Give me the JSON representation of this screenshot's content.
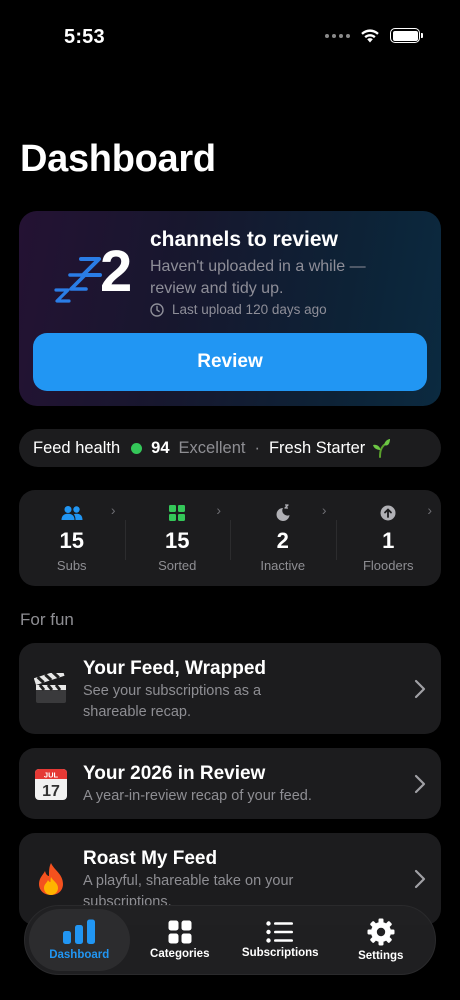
{
  "status_bar": {
    "time": "5:53"
  },
  "page": {
    "title": "Dashboard"
  },
  "review_card": {
    "count": "2",
    "title": "channels to review",
    "subtitle": "Haven't uploaded in a while — review and tidy up.",
    "last_upload": "Last upload 120 days ago",
    "button_label": "Review",
    "icon": "zzz-sleep-icon"
  },
  "feed_health": {
    "label": "Feed health",
    "score": "94",
    "rating": "Excellent",
    "separator": "·",
    "badge": "Fresh Starter",
    "status_color": "#34c759"
  },
  "stats": [
    {
      "value": "15",
      "label": "Subs",
      "icon": "people-icon"
    },
    {
      "value": "15",
      "label": "Sorted",
      "icon": "grid-icon"
    },
    {
      "value": "2",
      "label": "Inactive",
      "icon": "moon-zzz-icon"
    },
    {
      "value": "1",
      "label": "Flooders",
      "icon": "arrow-up-circle-icon"
    }
  ],
  "for_fun": {
    "label": "For fun",
    "items": [
      {
        "title": "Your Feed, Wrapped",
        "description": "See your subscriptions as a shareable recap.",
        "icon": "clapperboard-icon"
      },
      {
        "title": "Your 2026 in Review",
        "description": "A year-in-review recap of your feed.",
        "icon": "calendar-icon"
      },
      {
        "title": "Roast My Feed",
        "description": "A playful, shareable take on your subscriptions.",
        "icon": "fire-icon"
      }
    ]
  },
  "calendar_icon": {
    "month": "JUL",
    "day": "17"
  },
  "tab_bar": {
    "tabs": [
      {
        "label": "Dashboard",
        "icon": "chart-bars-icon",
        "active": true
      },
      {
        "label": "Categories",
        "icon": "grid-icon",
        "active": false
      },
      {
        "label": "Subscriptions",
        "icon": "list-icon",
        "active": false
      },
      {
        "label": "Settings",
        "icon": "gear-icon",
        "active": false
      }
    ]
  },
  "colors": {
    "accent": "#2196f3",
    "background": "#000000",
    "card": "#1c1c1e",
    "secondary_text": "#8e8e93"
  }
}
